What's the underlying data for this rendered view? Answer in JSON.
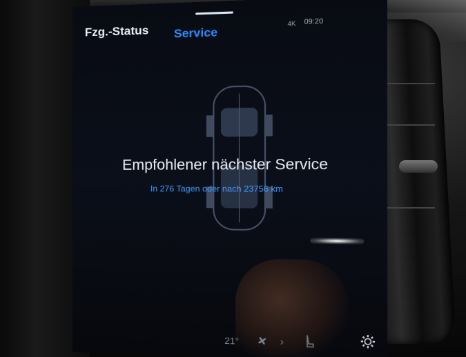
{
  "tabs": [
    {
      "label": "Fzg.-Status",
      "active": false
    },
    {
      "label": "Service",
      "active": true
    }
  ],
  "status_bar": {
    "time": "09:20",
    "icon": "connectivity-icon",
    "icon_text": "4K"
  },
  "main": {
    "headline": "Empfohlener nächster Service",
    "subline": "In 276 Tagen oder nach 23756 km"
  },
  "bottom_bar": {
    "temperature": "21°",
    "icons": [
      "fan-icon",
      "chevron-right-icon",
      "seat-heat-icon",
      "settings-gear-icon"
    ]
  },
  "colors": {
    "accent": "#2b8cff",
    "text": "#e9eef4",
    "background": "#080b12"
  }
}
